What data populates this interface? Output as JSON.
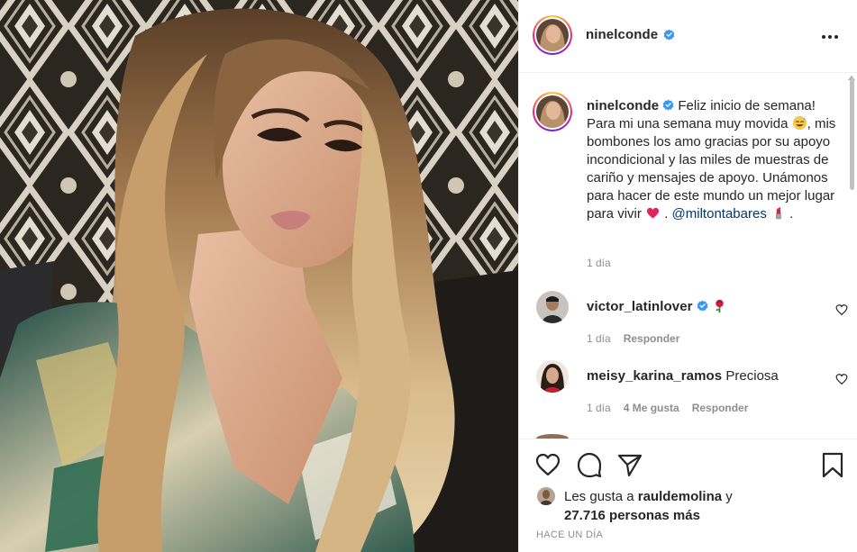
{
  "post": {
    "author": "ninelconde",
    "verified": true,
    "photo_alt": "ninelconde post photo"
  },
  "caption": {
    "author": "ninelconde",
    "text_line_1": "Feliz inicio de semana!",
    "text_line_2": "Para mi una semana muy movida",
    "text_rest": "mis bombones los amo gracias por su apoyo incondicional y las miles de muestras de cariño y mensajes de apoyo. Unámonos para hacer de este mundo un mejor lugar para vivir",
    "mention": "@miltontabares",
    "trailing": ".",
    "time": "1 día"
  },
  "comments": [
    {
      "author": "victor_latinlover",
      "verified": true,
      "text": "",
      "emoji": "rose",
      "time": "1 día",
      "likes": "",
      "reply": "Responder"
    },
    {
      "author": "meisy_karina_ramos",
      "verified": false,
      "text": "Preciosa",
      "time": "1 día",
      "likes": "4 Me gusta",
      "reply": "Responder"
    }
  ],
  "likes": {
    "prefix": "Les gusta a",
    "user": "raul​demolina",
    "conj": "y",
    "count": "27.716 personas más"
  },
  "posted": "Hace un día",
  "icons": {
    "more": "more-options-icon",
    "like": "heart-icon",
    "comment": "comment-icon",
    "share": "share-icon",
    "save": "bookmark-icon"
  },
  "colors": {
    "text": "#262626",
    "muted": "#8e8e8e",
    "link": "#00376b",
    "verified": "#3897f0",
    "border": "#efefef"
  }
}
